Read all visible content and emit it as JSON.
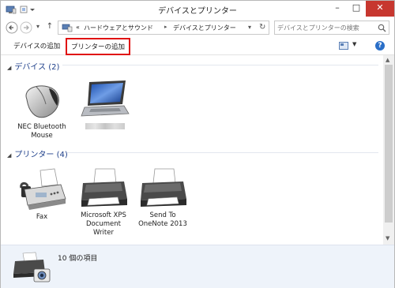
{
  "window": {
    "title": "デバイスとプリンター",
    "controls": {
      "minimize": "–",
      "maximize": "□",
      "close": "✕"
    }
  },
  "address": {
    "prefix": "«",
    "crumbs": [
      "ハードウェアとサウンド",
      "デバイスとプリンター"
    ],
    "separator": "▸"
  },
  "search": {
    "placeholder": "デバイスとプリンターの検索"
  },
  "toolbar": {
    "add_device": "デバイスの追加",
    "add_printer": "プリンターの追加",
    "help": "?",
    "highlight_color": "#e01010"
  },
  "groups": {
    "devices": {
      "header": "デバイス (2)",
      "items": [
        {
          "label_lines": [
            "NEC Bluetooth",
            "Mouse"
          ],
          "icon": "mouse-icon"
        },
        {
          "label_lines": [],
          "icon": "laptop-icon",
          "label_obscured": true
        }
      ]
    },
    "printers": {
      "header": "プリンター (4)",
      "items": [
        {
          "label_lines": [
            "Fax"
          ],
          "icon": "fax-icon"
        },
        {
          "label_lines": [
            "Microsoft XPS",
            "Document",
            "Writer"
          ],
          "icon": "printer-icon"
        },
        {
          "label_lines": [
            "Send To",
            "OneNote 2013"
          ],
          "icon": "printer-icon"
        }
      ]
    }
  },
  "details": {
    "count_text": "10 個の項目"
  },
  "colors": {
    "group_header": "#1e3f8a",
    "close_button": "#c7372f",
    "details_pane": "#eef3fa"
  }
}
